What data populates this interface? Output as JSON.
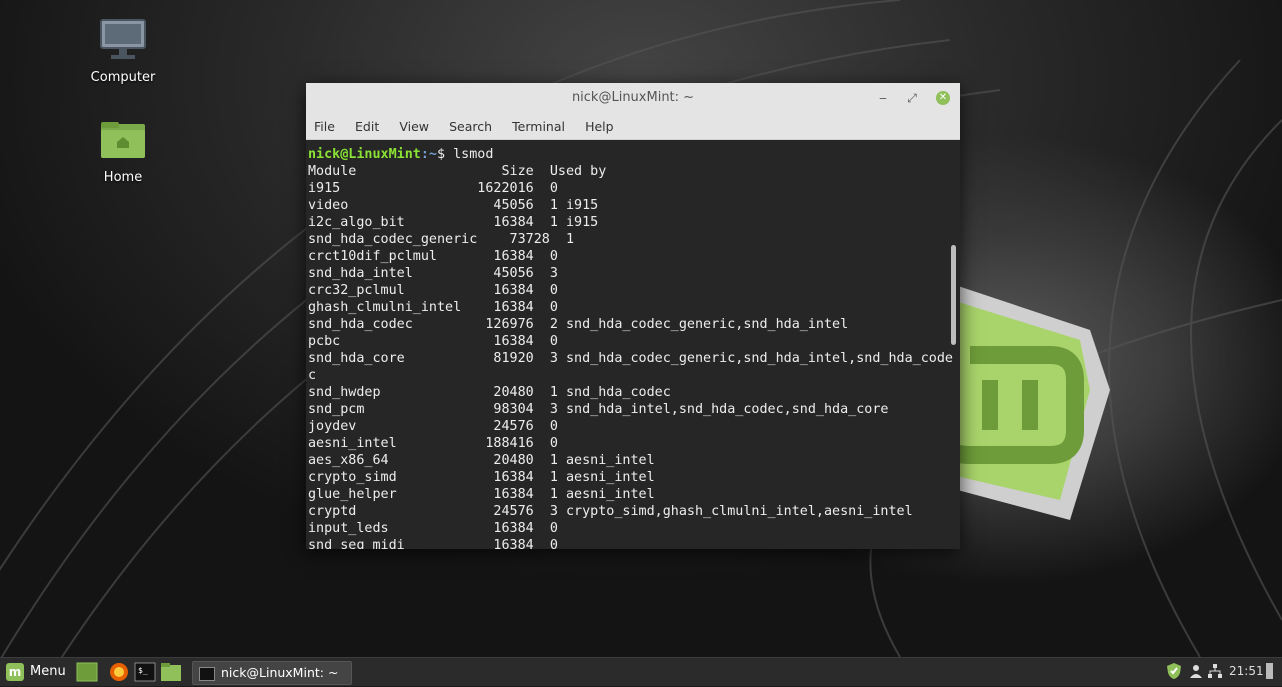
{
  "desktop": {
    "icons": [
      {
        "label": "Computer",
        "icon": "computer-icon"
      },
      {
        "label": "Home",
        "icon": "home-folder-icon"
      }
    ]
  },
  "window": {
    "title": "nick@LinuxMint: ~",
    "menu": [
      "File",
      "Edit",
      "View",
      "Search",
      "Terminal",
      "Help"
    ]
  },
  "terminal": {
    "prompt_user": "nick@LinuxMint",
    "prompt_path": ":~",
    "prompt_symbol": "$ ",
    "command": "lsmod",
    "header": "Module                  Size  Used by",
    "lines": [
      "i915                 1622016  0",
      "video                  45056  1 i915",
      "i2c_algo_bit           16384  1 i915",
      "snd_hda_codec_generic    73728  1",
      "crct10dif_pclmul       16384  0",
      "snd_hda_intel          45056  3",
      "crc32_pclmul           16384  0",
      "ghash_clmulni_intel    16384  0",
      "snd_hda_codec         126976  2 snd_hda_codec_generic,snd_hda_intel",
      "pcbc                   16384  0",
      "snd_hda_core           81920  3 snd_hda_codec_generic,snd_hda_intel,snd_hda_code",
      "c",
      "snd_hwdep              20480  1 snd_hda_codec",
      "snd_pcm                98304  3 snd_hda_intel,snd_hda_codec,snd_hda_core",
      "joydev                 24576  0",
      "aesni_intel           188416  0",
      "aes_x86_64             20480  1 aesni_intel",
      "crypto_simd            16384  1 aesni_intel",
      "glue_helper            16384  1 aesni_intel",
      "cryptd                 24576  3 crypto_simd,ghash_clmulni_intel,aesni_intel",
      "input_leds             16384  0",
      "snd_seq_midi           16384  0"
    ]
  },
  "taskbar": {
    "menu_label": "Menu",
    "task_label": "nick@LinuxMint: ~",
    "clock": "21:51",
    "colors": {
      "mint": "#8fc05a"
    }
  }
}
